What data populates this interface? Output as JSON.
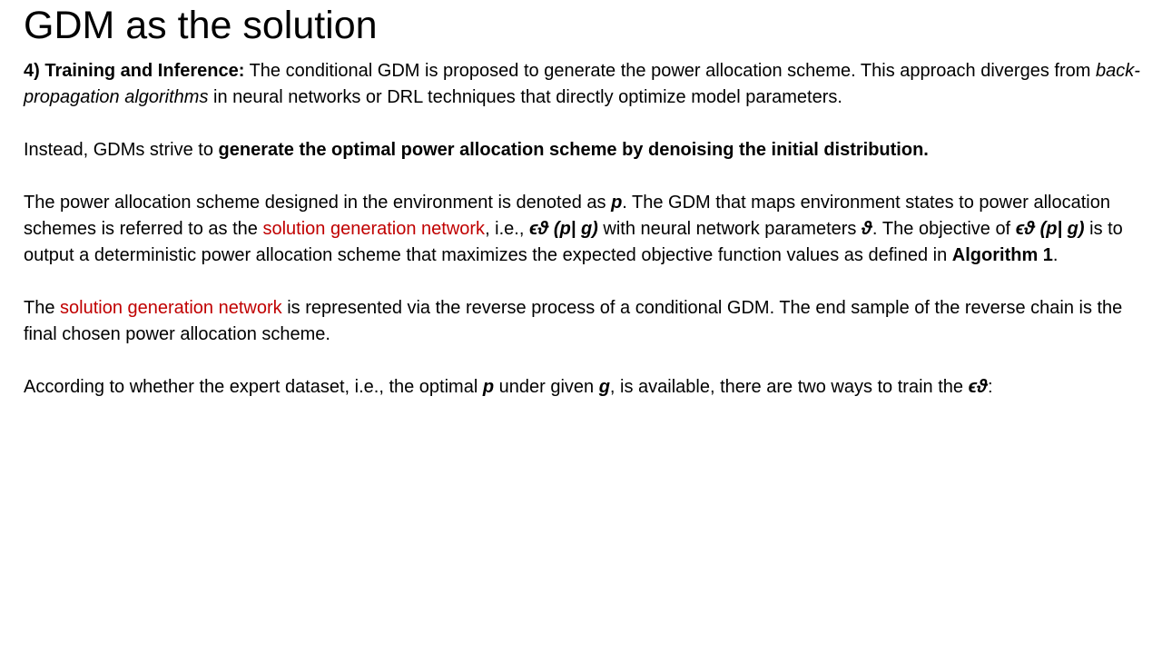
{
  "slide": {
    "title": "GDM as the solution",
    "p1": {
      "lead": "4) Training and Inference:",
      "text_a": " The conditional GDM is proposed to generate the power allocation scheme. This approach diverges from ",
      "italic": "back-propagation  algorithms",
      "text_b": " in neural networks or DRL techniques that directly optimize model parameters."
    },
    "p2": {
      "text_a": "Instead, GDMs strive to ",
      "bold": "generate the optimal power allocation scheme by denoising the initial distribution."
    },
    "p3": {
      "text_a": "The power allocation scheme designed in the environment is denoted as ",
      "p_symbol": "p",
      "text_b": ". The GDM that maps environment states to power allocation schemes is referred to as the ",
      "red_term": "solution generation network",
      "text_c": ", i.e., ",
      "formula_1": "ϵϑ (p| g)",
      "text_d": " with neural network parameters ",
      "theta": "ϑ",
      "text_e": ". The objective of ",
      "formula_2": "ϵϑ (p| g)",
      "text_f": " is to output a deterministic power allocation scheme that maximizes the expected objective function values as defined in ",
      "algorithm": "Algorithm 1",
      "text_g": "."
    },
    "p4": {
      "text_a": "The ",
      "red_term": "solution generation network",
      "text_b": " is represented via the reverse process of a conditional GDM. The end sample of the reverse chain is the final chosen power allocation scheme."
    },
    "p5": {
      "text_a": "According to whether the expert dataset, i.e., the optimal ",
      "p_symbol": "p",
      "text_b": " under given ",
      "g_symbol": "g",
      "text_c": ", is available, there are two ways to train the ",
      "formula": "ϵϑ",
      "text_d": ":"
    }
  }
}
